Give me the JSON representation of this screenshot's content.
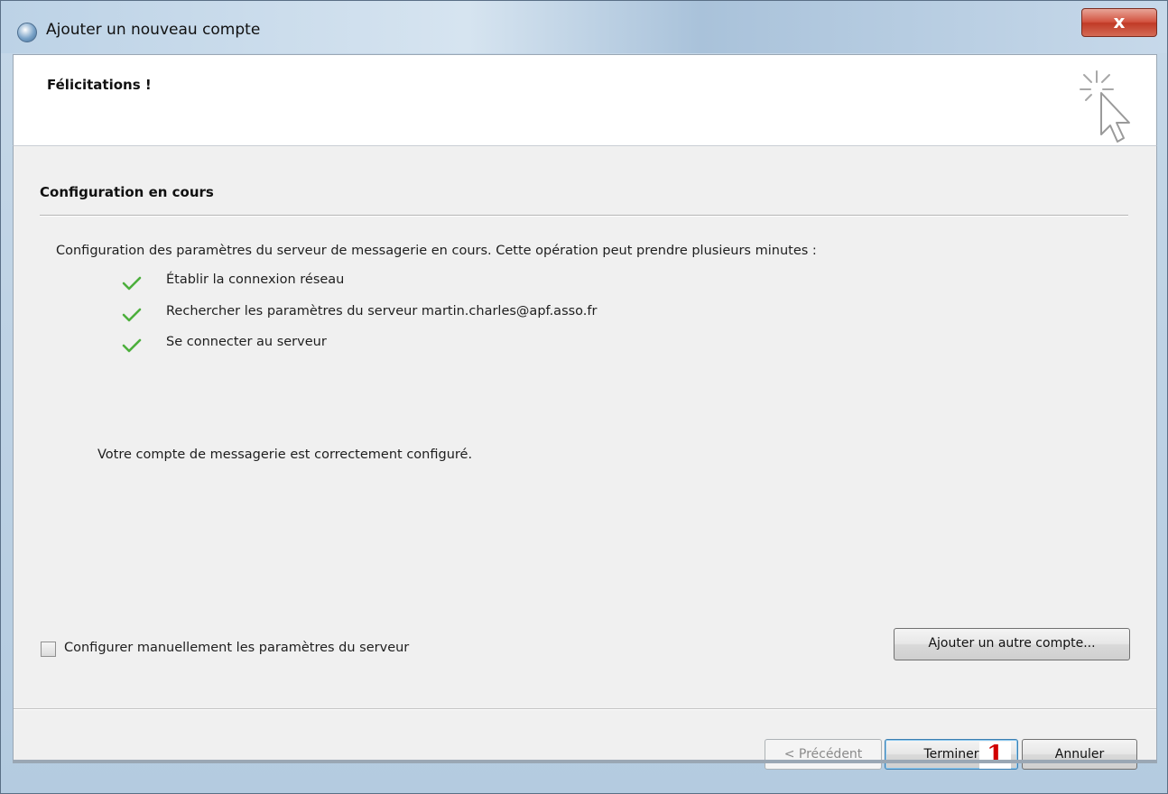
{
  "window": {
    "title": "Ajouter un nouveau compte",
    "close_label": "x"
  },
  "header": {
    "title": "Félicitations !"
  },
  "content": {
    "section_title": "Configuration en cours",
    "description": "Configuration des paramètres du serveur de messagerie en cours. Cette opération peut prendre plusieurs minutes :",
    "steps": [
      {
        "label": "Établir la connexion réseau",
        "status": "done"
      },
      {
        "label": "Rechercher les paramètres du serveur martin.charles@apf.asso.fr",
        "status": "done"
      },
      {
        "label": "Se connecter au serveur",
        "status": "done"
      }
    ],
    "success_message": "Votre compte de messagerie est correctement configuré.",
    "manual_config_label": "Configurer manuellement les paramètres du serveur",
    "manual_config_checked": false,
    "add_account_label": "Ajouter un autre compte..."
  },
  "footer": {
    "prev_label": "< Précédent",
    "finish_label": "Terminer",
    "cancel_label": "Annuler"
  },
  "annotation": {
    "marker": "1"
  },
  "colors": {
    "check": "#4caf3c",
    "marker": "#d10000"
  }
}
